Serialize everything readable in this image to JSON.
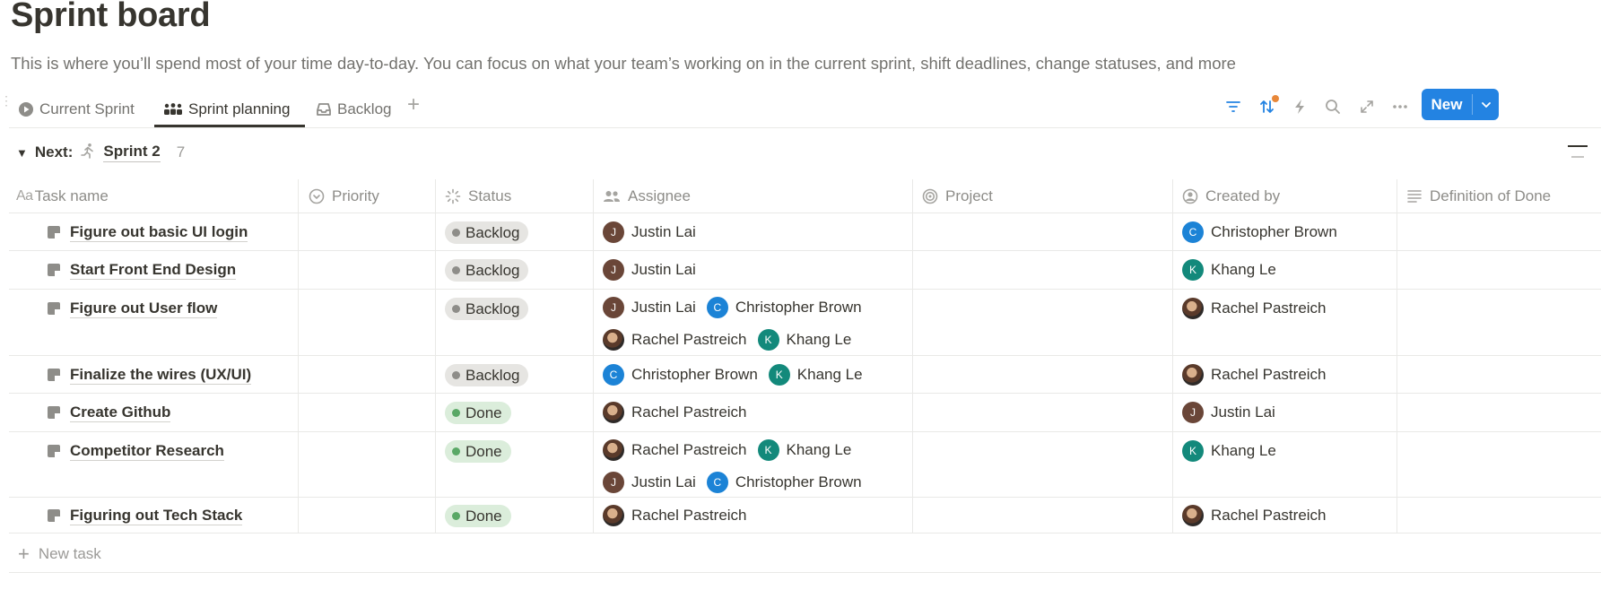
{
  "page": {
    "title": "Sprint board",
    "description": "This is where you’ll spend most of your time day-to-day. You can focus on what your team’s working on in the current sprint, shift deadlines, change statuses, and more"
  },
  "views": [
    {
      "label": "Current Sprint",
      "icon": "play-circle-icon",
      "active": false
    },
    {
      "label": "Sprint planning",
      "icon": "team-icon",
      "active": true
    },
    {
      "label": "Backlog",
      "icon": "inbox-icon",
      "active": false
    }
  ],
  "toolbar": {
    "new_label": "New",
    "accent": "#2383e2",
    "sort_badge_color": "#e8883a"
  },
  "group": {
    "prefix": "Next:",
    "name": "Sprint 2",
    "count": "7"
  },
  "columns": {
    "task": "Task name",
    "priority": "Priority",
    "status": "Status",
    "assignee": "Assignee",
    "project": "Project",
    "created_by": "Created by",
    "dod": "Definition of Done"
  },
  "rows": [
    {
      "name": "Figure out basic UI login",
      "status": "Backlog",
      "assignees": [
        "Justin Lai"
      ],
      "created_by": "Christopher Brown"
    },
    {
      "name": "Start Front End Design",
      "status": "Backlog",
      "assignees": [
        "Justin Lai"
      ],
      "created_by": "Khang Le"
    },
    {
      "name": "Figure out User flow",
      "status": "Backlog",
      "assignees": [
        "Justin Lai",
        "Christopher Brown",
        "Rachel Pastreich",
        "Khang Le"
      ],
      "created_by": "Rachel Pastreich"
    },
    {
      "name": "Finalize the wires (UX/UI)",
      "status": "Backlog",
      "assignees": [
        "Christopher Brown",
        "Khang Le"
      ],
      "created_by": "Rachel Pastreich"
    },
    {
      "name": "Create Github",
      "status": "Done",
      "assignees": [
        "Rachel Pastreich"
      ],
      "created_by": "Justin Lai"
    },
    {
      "name": "Competitor Research",
      "status": "Done",
      "assignees": [
        "Rachel Pastreich",
        "Khang Le",
        "Justin Lai",
        "Christopher Brown"
      ],
      "created_by": "Khang Le"
    },
    {
      "name": "Figuring out Tech Stack",
      "status": "Done",
      "assignees": [
        "Rachel Pastreich"
      ],
      "created_by": "Rachel Pastreich"
    }
  ],
  "footer": {
    "new_task_label": "New task"
  },
  "status_colors": {
    "Backlog": "#e6e5e2",
    "Done": "#dbeddb"
  }
}
